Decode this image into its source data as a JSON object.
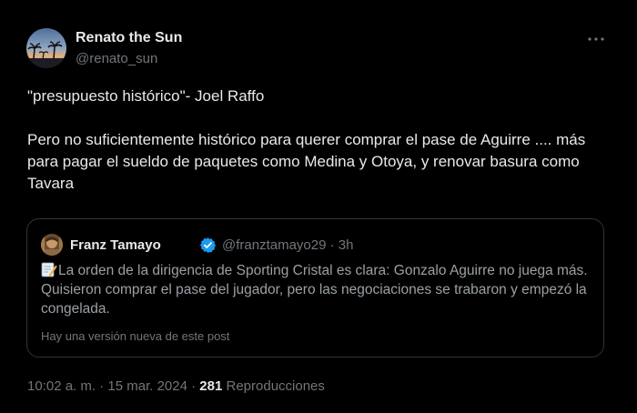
{
  "author": {
    "name": "Renato the Sun",
    "handle": "@renato_sun"
  },
  "tweet": {
    "line1": "\"presupuesto histórico\"- Joel Raffo",
    "line2": "Pero no suficientemente histórico  para querer comprar el pase de Aguirre .... más  para pagar el sueldo de paquetes como Medina y Otoya, y renovar basura como Tavara"
  },
  "quote": {
    "name": "Franz Tamayo",
    "handle": "@franztamayo29",
    "separator": "·",
    "time": "3h",
    "text": "La orden de la dirigencia de Sporting Cristal es clara: Gonzalo Aguirre no juega más. Quisieron comprar el pase del jugador, pero las negociaciones se trabaron y empezó la congelada.",
    "new_version_notice": "Hay una versión nueva de este post",
    "icon": "memo-icon"
  },
  "footer": {
    "time": "10:02 a. m.",
    "sep1": "·",
    "date": "15 mar. 2024",
    "sep2": "·",
    "views_count": "281",
    "views_label": "Reproducciones"
  },
  "colors": {
    "background": "#000000",
    "text": "#e7e9ea",
    "secondary": "#71767b",
    "border": "#2f3336",
    "verified": "#1d9bf0"
  }
}
